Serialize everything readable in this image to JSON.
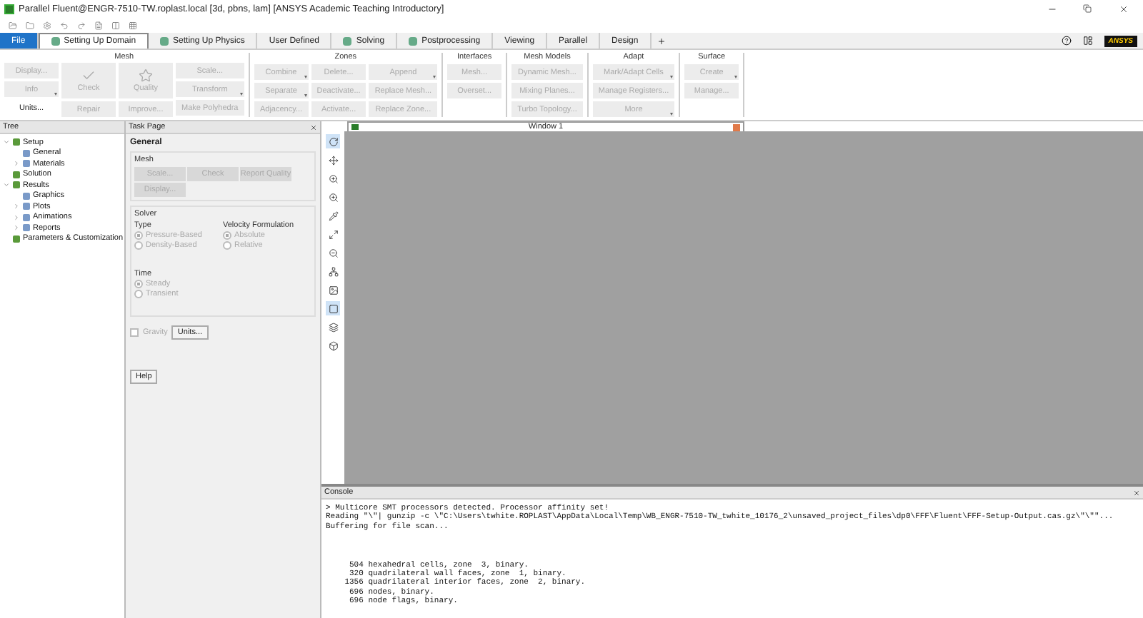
{
  "window": {
    "title": "Parallel Fluent@ENGR-7510-TW.roplast.local  [3d, pbns, lam] [ANSYS Academic Teaching Introductory]"
  },
  "ribbon_tabs": [
    {
      "label": "File",
      "selected": false,
      "kind": "file"
    },
    {
      "label": "Setting Up Domain",
      "selected": true,
      "kind": "icon"
    },
    {
      "label": "Setting Up Physics",
      "selected": false,
      "kind": "icon"
    },
    {
      "label": "User Defined",
      "selected": false,
      "kind": "plain"
    },
    {
      "label": "Solving",
      "selected": false,
      "kind": "icon"
    },
    {
      "label": "Postprocessing",
      "selected": false,
      "kind": "icon"
    },
    {
      "label": "Viewing",
      "selected": false,
      "kind": "plain"
    },
    {
      "label": "Parallel",
      "selected": false,
      "kind": "plain"
    },
    {
      "label": "Design",
      "selected": false,
      "kind": "plain"
    }
  ],
  "brand": "ANSYS",
  "ribbon_groups": [
    {
      "title": "Mesh",
      "columns": [
        [
          {
            "label": "Display...",
            "disabled": true,
            "menu": false,
            "kind": "small"
          },
          {
            "label": "Info",
            "disabled": true,
            "menu": true,
            "kind": "small"
          },
          {
            "label": "Units...",
            "disabled": false,
            "menu": false,
            "kind": "small"
          }
        ],
        [
          {
            "label": "Check",
            "disabled": true,
            "menu": false,
            "kind": "large"
          },
          {
            "label": "Repair",
            "disabled": true,
            "menu": false,
            "kind": "small"
          }
        ],
        [
          {
            "label": "Quality",
            "disabled": true,
            "menu": false,
            "kind": "large"
          },
          {
            "label": "Improve...",
            "disabled": true,
            "menu": false,
            "kind": "small"
          }
        ],
        [
          {
            "label": "Scale...",
            "disabled": true,
            "menu": false,
            "kind": "small"
          },
          {
            "label": "Transform",
            "disabled": true,
            "menu": true,
            "kind": "small"
          },
          {
            "label": "Make Polyhedra",
            "disabled": true,
            "menu": false,
            "kind": "small"
          }
        ]
      ]
    },
    {
      "title": "Zones",
      "columns": [
        [
          {
            "label": "Combine",
            "disabled": true,
            "menu": true,
            "kind": "small"
          },
          {
            "label": "Separate",
            "disabled": true,
            "menu": true,
            "kind": "small"
          },
          {
            "label": "Adjacency...",
            "disabled": true,
            "menu": false,
            "kind": "small"
          }
        ],
        [
          {
            "label": "Delete...",
            "disabled": true,
            "menu": false,
            "kind": "small"
          },
          {
            "label": "Deactivate...",
            "disabled": true,
            "menu": false,
            "kind": "small"
          },
          {
            "label": "Activate...",
            "disabled": true,
            "menu": false,
            "kind": "small"
          }
        ],
        [
          {
            "label": "Append",
            "disabled": true,
            "menu": true,
            "kind": "small"
          },
          {
            "label": "Replace Mesh...",
            "disabled": true,
            "menu": false,
            "kind": "small"
          },
          {
            "label": "Replace Zone...",
            "disabled": true,
            "menu": false,
            "kind": "small"
          }
        ]
      ]
    },
    {
      "title": "Interfaces",
      "columns": [
        [
          {
            "label": "Mesh...",
            "disabled": true,
            "menu": false,
            "kind": "small"
          },
          {
            "label": "Overset...",
            "disabled": true,
            "menu": false,
            "kind": "small"
          }
        ]
      ]
    },
    {
      "title": "Mesh Models",
      "columns": [
        [
          {
            "label": "Dynamic Mesh...",
            "disabled": true,
            "menu": false,
            "kind": "small"
          },
          {
            "label": "Mixing Planes...",
            "disabled": true,
            "menu": false,
            "kind": "small"
          },
          {
            "label": "Turbo Topology...",
            "disabled": true,
            "menu": false,
            "kind": "small"
          }
        ]
      ]
    },
    {
      "title": "Adapt",
      "columns": [
        [
          {
            "label": "Mark/Adapt Cells",
            "disabled": true,
            "menu": true,
            "kind": "small"
          },
          {
            "label": "Manage Registers...",
            "disabled": true,
            "menu": false,
            "kind": "small"
          },
          {
            "label": "More",
            "disabled": true,
            "menu": true,
            "kind": "small"
          }
        ]
      ]
    },
    {
      "title": "Surface",
      "columns": [
        [
          {
            "label": "Create",
            "disabled": true,
            "menu": true,
            "kind": "small"
          },
          {
            "label": "Manage...",
            "disabled": true,
            "menu": false,
            "kind": "small"
          }
        ]
      ]
    }
  ],
  "tree": {
    "title": "Tree",
    "items": [
      {
        "label": "Setup",
        "expanded": true,
        "children": [
          {
            "label": "General"
          },
          {
            "label": "Materials",
            "expanded": false
          }
        ]
      },
      {
        "label": "Solution"
      },
      {
        "label": "Results",
        "expanded": true,
        "children": [
          {
            "label": "Graphics"
          },
          {
            "label": "Plots",
            "expanded": false
          },
          {
            "label": "Animations",
            "expanded": false
          },
          {
            "label": "Reports",
            "expanded": false
          }
        ]
      },
      {
        "label": "Parameters & Customization"
      }
    ]
  },
  "task_page": {
    "title": "Task Page",
    "heading": "General",
    "mesh": {
      "title": "Mesh",
      "buttons": [
        {
          "label": "Scale...",
          "disabled": true
        },
        {
          "label": "Check",
          "disabled": true
        },
        {
          "label": "Report Quality",
          "disabled": true
        },
        {
          "label": "Display...",
          "disabled": true
        }
      ]
    },
    "solver": {
      "title": "Solver",
      "type": {
        "title": "Type",
        "options": [
          {
            "label": "Pressure-Based",
            "selected": true
          },
          {
            "label": "Density-Based",
            "selected": false
          }
        ]
      },
      "velocity": {
        "title": "Velocity Formulation",
        "options": [
          {
            "label": "Absolute",
            "selected": true
          },
          {
            "label": "Relative",
            "selected": false
          }
        ]
      },
      "time": {
        "title": "Time",
        "options": [
          {
            "label": "Steady",
            "selected": true
          },
          {
            "label": "Transient",
            "selected": false
          }
        ]
      }
    },
    "gravity": {
      "label": "Gravity",
      "checked": false
    },
    "units_button": "Units...",
    "help_button": "Help"
  },
  "graphics_tools": [
    {
      "kind": "rotate",
      "selected": true
    },
    {
      "kind": "pan",
      "selected": false
    },
    {
      "kind": "zoom",
      "selected": false
    },
    {
      "kind": "zoom",
      "selected": false
    },
    {
      "kind": "probe",
      "selected": false
    },
    {
      "kind": "zoom-fit",
      "selected": false
    },
    {
      "kind": "zoom-out",
      "selected": false
    },
    {
      "kind": "nodes",
      "selected": false
    },
    {
      "kind": "image",
      "selected": false
    },
    {
      "kind": "box",
      "selected": true
    },
    {
      "kind": "layers",
      "selected": false
    },
    {
      "kind": "view",
      "selected": false
    }
  ],
  "graphics_window": {
    "title": "Window 1"
  },
  "console": {
    "title": "Console",
    "blocks": [
      [
        "> Multicore SMT processors detected. Processor affinity set!",
        "Reading \"\\\"| gunzip -c \\\"C:\\Users\\twhite.ROPLAST\\AppData\\Local\\Temp\\WB_ENGR-7510-TW_twhite_10176_2\\unsaved_project_files\\dp0\\FFF\\Fluent\\FFF-Setup-Output.cas.gz\\\"\\\"\"...",
        "Buffering for file scan..."
      ],
      [
        "     504 hexahedral cells, zone  3, binary.",
        "     320 quadrilateral wall faces, zone  1, binary.",
        "    1356 quadrilateral interior faces, zone  2, binary.",
        "     696 nodes, binary.",
        "     696 node flags, binary."
      ]
    ]
  }
}
